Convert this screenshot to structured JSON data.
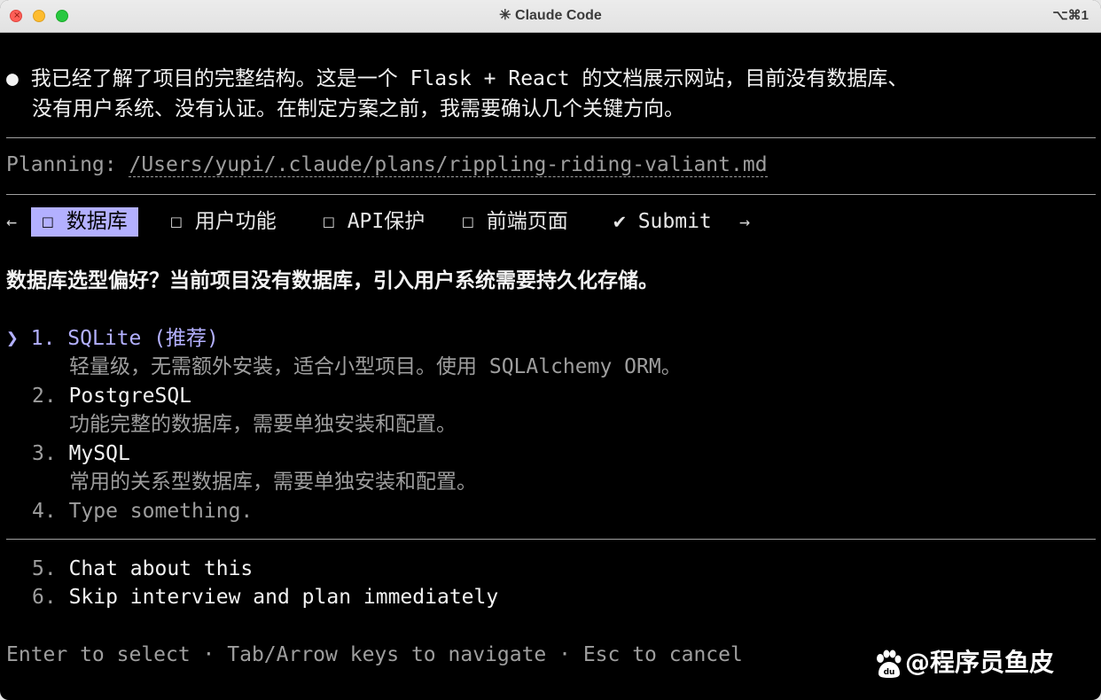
{
  "window": {
    "title": "✳ Claude Code",
    "shortcut": "⌥⌘1",
    "close_glyph": "×"
  },
  "message": {
    "bullet": "●",
    "line1": "我已经了解了项目的完整结构。这是一个 Flask + React 的文档展示网站，目前没有数据库、",
    "line2": "没有用户系统、没有认证。在制定方案之前，我需要确认几个关键方向。"
  },
  "planning": {
    "label": "Planning: ",
    "path": "/Users/yupi/.claude/plans/rippling-riding-valiant.md"
  },
  "tabs": {
    "left_arrow": "←",
    "right_arrow": "→",
    "items": [
      {
        "label": "☐ 数据库",
        "active": true
      },
      {
        "label": "☐ 用户功能",
        "active": false
      },
      {
        "label": "☐ API保护",
        "active": false
      },
      {
        "label": "☐ 前端页面",
        "active": false
      },
      {
        "label": "✔ Submit",
        "active": false
      }
    ]
  },
  "question": "数据库选型偏好？当前项目没有数据库，引入用户系统需要持久化存储。",
  "options": {
    "pointer": "❯",
    "items": [
      {
        "number": "1.",
        "label": "SQLite (推荐)",
        "description": "轻量级，无需额外安装，适合小型项目。使用 SQLAlchemy ORM。",
        "selected": true
      },
      {
        "number": "2.",
        "label": "PostgreSQL",
        "description": "功能完整的数据库，需要单独安装和配置。",
        "selected": false
      },
      {
        "number": "3.",
        "label": "MySQL",
        "description": "常用的关系型数据库，需要单独安装和配置。",
        "selected": false
      },
      {
        "number": "4.",
        "label": "Type something.",
        "description": "",
        "selected": false
      }
    ],
    "extra": [
      {
        "number": "5.",
        "label": "Chat about this"
      },
      {
        "number": "6.",
        "label": "Skip interview and plan immediately"
      }
    ]
  },
  "footer": {
    "hint": "Enter to select · Tab/Arrow keys to navigate · Esc to cancel"
  },
  "watermark": {
    "text": "@程序员鱼皮",
    "logo_text": "du",
    "logo_icon": "baidu-paw-icon"
  },
  "colors": {
    "background": "#000000",
    "accent": "#b3b0ff",
    "text": "#d4d4d4",
    "muted": "#9e9e9e"
  }
}
